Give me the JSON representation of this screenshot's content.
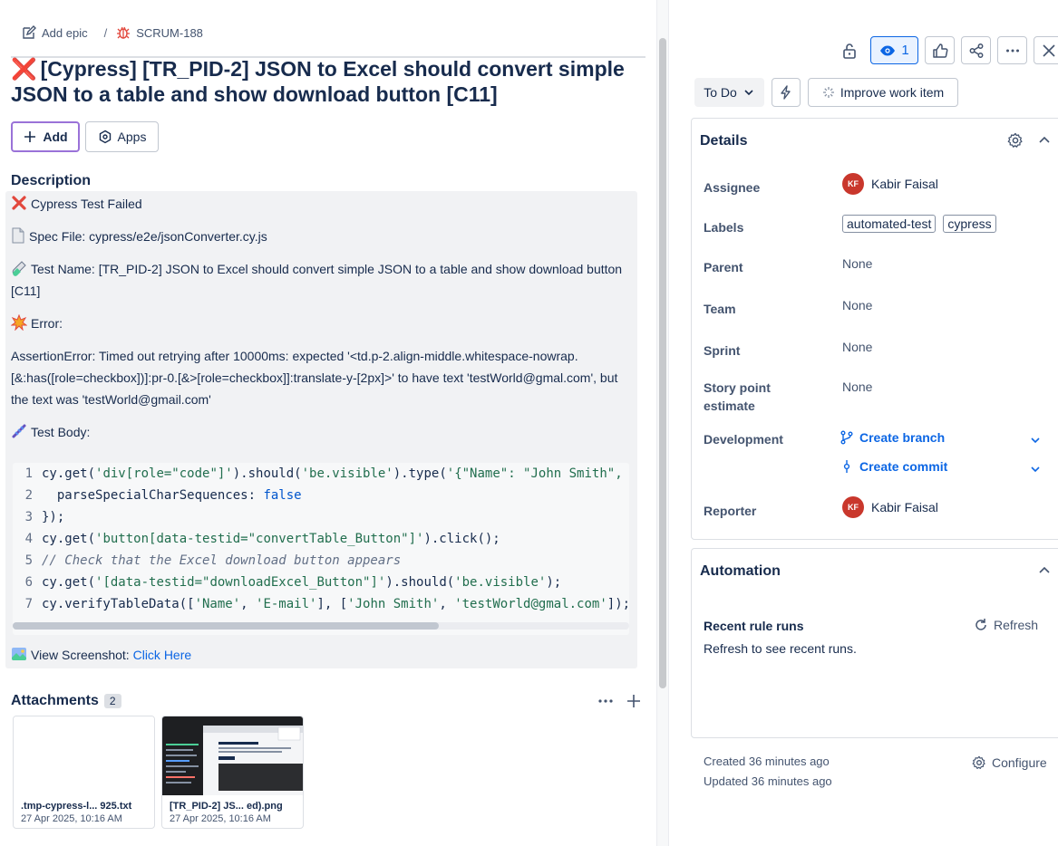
{
  "breadcrumb": {
    "add_epic": "Add epic",
    "separator": "/",
    "issue_key": "SCRUM-188"
  },
  "issue": {
    "title_mark": "❌",
    "title": "[Cypress] [TR_PID-2] JSON to Excel should convert simple JSON to a table and show download button [C11]"
  },
  "actions": {
    "add_label": "Add",
    "apps_label": "Apps"
  },
  "description": {
    "heading": "Description",
    "failed": "Cypress Test Failed",
    "spec_file": "Spec File: cypress/e2e/jsonConverter.cy.js",
    "test_name": "Test Name: [TR_PID-2] JSON to Excel should convert simple JSON to a table and show download button [C11]",
    "error_label": "Error:",
    "error_text": "AssertionError: Timed out retrying after 10000ms: expected '<td.p-2.align-middle.whitespace-nowrap.[&:has([role=checkbox])]:pr-0.[&>[role=checkbox]]:translate-y-[2px]>' to have text 'testWorld@gmal.com', but the text was 'testWorld@gmail.com'",
    "test_body_label": "Test Body:",
    "screenshot_label": "View Screenshot:",
    "screenshot_link": "Click Here"
  },
  "code": {
    "line_numbers": [
      "1",
      "2",
      "3",
      "4",
      "5",
      "6",
      "7"
    ],
    "l1a": "cy.get(",
    "l1b": "'div[role=\"code\"]'",
    "l1c": ").should(",
    "l1d": "'be.visible'",
    "l1e": ").type(",
    "l1f": "'{\"Name\": \"John Smith\", '",
    "l2a": "  parseSpecialCharSequences: ",
    "l2b": "false",
    "l3a": "});",
    "l4a": "cy.get(",
    "l4b": "'button[data-testid=\"convertTable_Button\"]'",
    "l4c": ").click();",
    "l5a": "// Check that the Excel download button appears",
    "l6a": "cy.get(",
    "l6b": "'[data-testid=\"downloadExcel_Button\"]'",
    "l6c": ").should(",
    "l6d": "'be.visible'",
    "l6e": ");",
    "l7a": "cy.verifyTableData([",
    "l7b": "'Name'",
    "l7c": ", ",
    "l7d": "'E-mail'",
    "l7e": "], [",
    "l7f": "'John Smith'",
    "l7g": ", ",
    "l7h": "'testWorld@gmal.com'",
    "l7i": "]);"
  },
  "attachments": {
    "heading": "Attachments",
    "count": "2",
    "items": [
      {
        "name": ".tmp-cypress-l... 925.txt",
        "date": "27 Apr 2025, 10:16 AM"
      },
      {
        "name": "[TR_PID-2] JS... ed).png",
        "date": "27 Apr 2025, 10:16 AM"
      }
    ]
  },
  "toolbar": {
    "watch_count": "1"
  },
  "status": {
    "label": "To Do",
    "improve_label": "Improve work item"
  },
  "details": {
    "heading": "Details",
    "assignee_label": "Assignee",
    "assignee_initials": "KF",
    "assignee_name": "Kabir Faisal",
    "labels_label": "Labels",
    "labels": [
      "automated-test",
      "cypress"
    ],
    "parent_label": "Parent",
    "parent_value": "None",
    "team_label": "Team",
    "team_value": "None",
    "sprint_label": "Sprint",
    "sprint_value": "None",
    "story_points_label_1": "Story point",
    "story_points_label_2": "estimate",
    "story_points_value": "None",
    "development_label": "Development",
    "create_branch": "Create branch",
    "create_commit": "Create commit",
    "reporter_label": "Reporter",
    "reporter_initials": "KF",
    "reporter_name": "Kabir Faisal"
  },
  "automation": {
    "heading": "Automation",
    "recent_runs": "Recent rule runs",
    "refresh": "Refresh",
    "hint": "Refresh to see recent runs."
  },
  "footer": {
    "created": "Created 36 minutes ago",
    "updated": "Updated 36 minutes ago",
    "configure": "Configure"
  },
  "colors": {
    "accent": "#0c66e4",
    "error": "#e2483d",
    "avatar": "#c9372c",
    "add_border": "#9a72d8"
  }
}
